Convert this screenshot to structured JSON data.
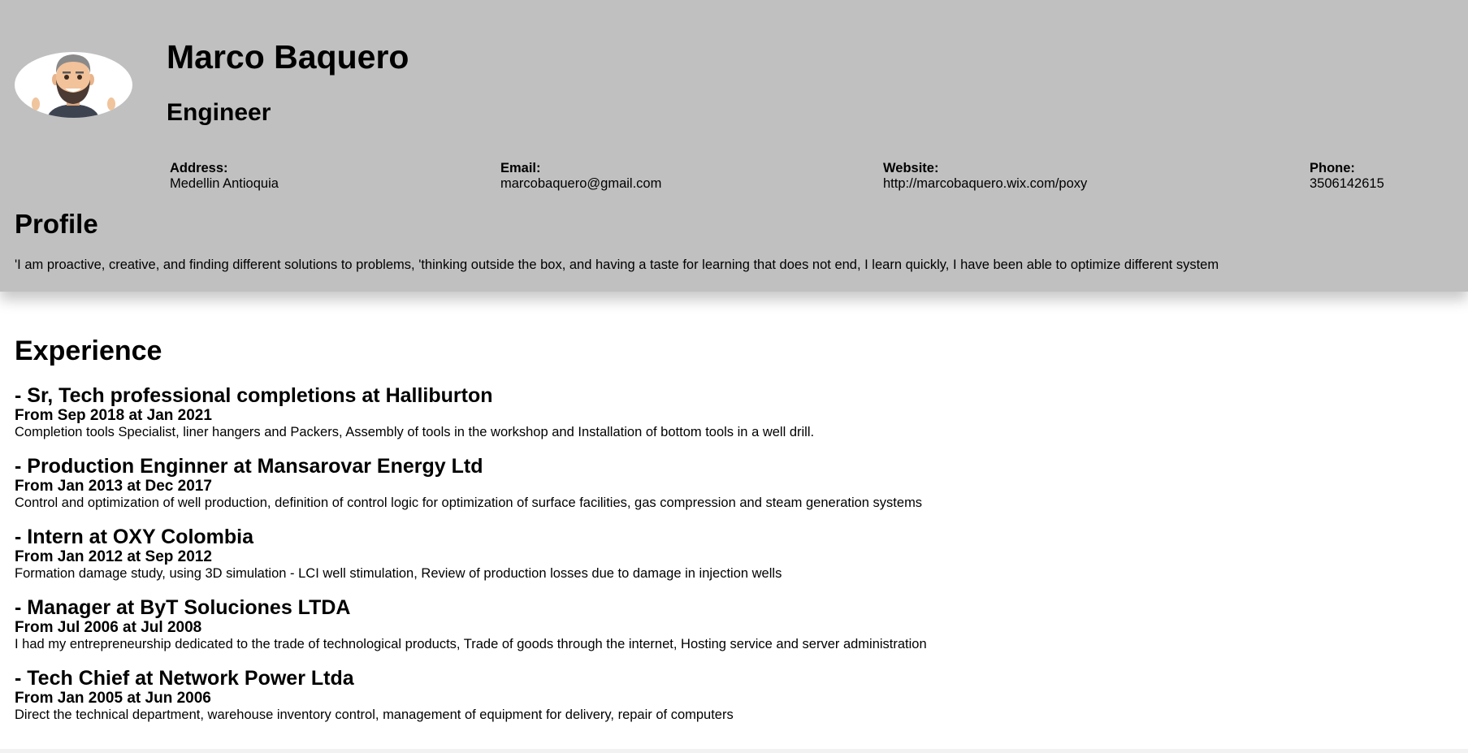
{
  "header": {
    "name": "Marco Baquero",
    "role": "Engineer",
    "avatar_icon": "bearded-man-avatar",
    "background_color": "#c0c0c0",
    "contact": {
      "address": {
        "label": "Address:",
        "value": "Medellin Antioquia"
      },
      "email": {
        "label": "Email:",
        "value": "marcobaquero@gmail.com"
      },
      "website": {
        "label": "Website:",
        "value": "http://marcobaquero.wix.com/poxy"
      },
      "phone": {
        "label": "Phone:",
        "value": "3506142615"
      }
    }
  },
  "profile": {
    "title": "Profile",
    "text": "'I am proactive, creative, and finding different solutions to problems, 'thinking outside the box, and having a taste for learning that does not end, I learn quickly, I have been able to optimize different system"
  },
  "experience": {
    "title": "Experience",
    "jobs": [
      {
        "title": "- Sr, Tech professional completions at Halliburton",
        "dates": "From Sep 2018 at Jan 2021",
        "description": "Completion tools Specialist, liner hangers and Packers, Assembly of tools in the workshop and Installation of bottom tools in a well drill."
      },
      {
        "title": "- Production Enginner at Mansarovar Energy Ltd",
        "dates": "From Jan 2013 at Dec 2017",
        "description": "Control and optimization of well production, definition of control logic for optimization of surface facilities, gas compression and steam generation systems"
      },
      {
        "title": "- Intern at OXY Colombia",
        "dates": "From Jan 2012 at Sep 2012",
        "description": "Formation damage study, using 3D simulation - LCI well stimulation, Review of production losses due to damage in injection wells"
      },
      {
        "title": "- Manager at ByT Soluciones LTDA",
        "dates": "From Jul 2006 at Jul 2008",
        "description": "I had my entrepreneurship dedicated to the trade of technological products, Trade of goods through the internet, Hosting service and server administration"
      },
      {
        "title": "- Tech Chief at Network Power Ltda",
        "dates": "From Jan 2005 at Jun 2006",
        "description": "Direct the technical department, warehouse inventory control, management of equipment for delivery, repair of computers"
      }
    ]
  }
}
